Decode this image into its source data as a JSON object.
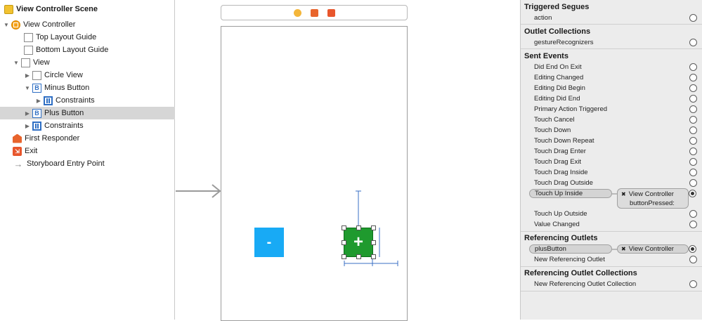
{
  "outline": {
    "items": [
      {
        "label": "View Controller Scene"
      },
      {
        "label": "View Controller"
      },
      {
        "label": "Top Layout Guide"
      },
      {
        "label": "Bottom Layout Guide"
      },
      {
        "label": "View"
      },
      {
        "label": "Circle View"
      },
      {
        "label": "Minus Button"
      },
      {
        "label": "Constraints"
      },
      {
        "label": "Plus Button"
      },
      {
        "label": "Constraints"
      },
      {
        "label": "First Responder"
      },
      {
        "label": "Exit"
      },
      {
        "label": "Storyboard Entry Point"
      }
    ],
    "button_glyph": "B",
    "selected_item": "Plus Button",
    "icons": [
      "scene-icon",
      "view-controller-icon",
      "layout-guide-icon",
      "view-icon",
      "button-icon",
      "constraints-icon",
      "first-responder-icon",
      "exit-icon",
      "entry-point-arrow-icon"
    ]
  },
  "canvas": {
    "minus_label": "-",
    "plus_label": "+",
    "colors": {
      "minus_button": "#18aaf5",
      "plus_button": "#1f9a2e"
    }
  },
  "inspector": {
    "triggered_segues": {
      "title": "Triggered Segues",
      "items": [
        "action"
      ]
    },
    "outlet_collections": {
      "title": "Outlet Collections",
      "items": [
        "gestureRecognizers"
      ]
    },
    "sent_events": {
      "title": "Sent Events",
      "items": [
        "Did End On Exit",
        "Editing Changed",
        "Editing Did Begin",
        "Editing Did End",
        "Primary Action Triggered",
        "Touch Cancel",
        "Touch Down",
        "Touch Down Repeat",
        "Touch Drag Enter",
        "Touch Drag Exit",
        "Touch Drag Inside",
        "Touch Drag Outside",
        "Touch Up Inside",
        "Touch Up Outside",
        "Value Changed"
      ],
      "connection": {
        "event": "Touch Up Inside",
        "target": "View Controller",
        "action": "buttonPressed:"
      }
    },
    "referencing_outlets": {
      "title": "Referencing Outlets",
      "connection": {
        "outlet": "plusButton",
        "target": "View Controller"
      },
      "new_item": "New Referencing Outlet"
    },
    "referencing_outlet_collections": {
      "title": "Referencing Outlet Collections",
      "new_item": "New Referencing Outlet Collection"
    },
    "remove_glyph": "✖"
  }
}
